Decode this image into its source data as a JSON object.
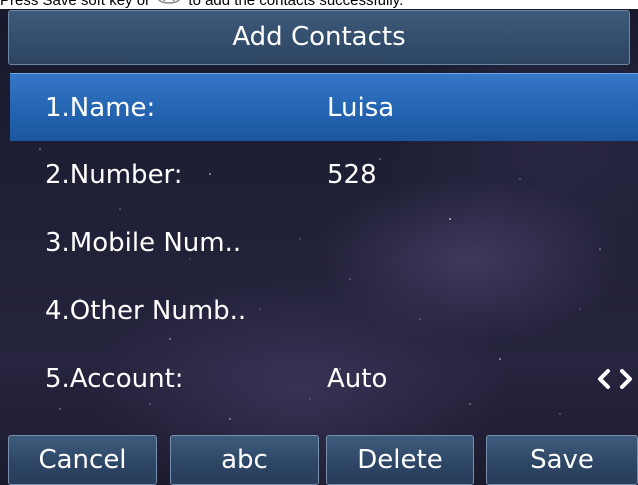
{
  "caption": {
    "text_before": "Press Save soft key or",
    "ok_icon": "ok-key-icon",
    "text_after": "to add the contacts successfully."
  },
  "screen": {
    "title": "Add Contacts",
    "fields": [
      {
        "label": "1.Name:",
        "value": "Luisa",
        "selected": true
      },
      {
        "label": "2.Number:",
        "value": "528",
        "selected": false
      },
      {
        "label": "3.Mobile Num..",
        "value": "",
        "selected": false
      },
      {
        "label": "4.Other Numb..",
        "value": "",
        "selected": false
      },
      {
        "label": "5.Account:",
        "value": "Auto",
        "selected": false,
        "has_arrows": true
      }
    ],
    "softkeys": [
      "Cancel",
      "abc",
      "Delete",
      "Save"
    ]
  },
  "colors": {
    "selection": "#2566b3",
    "softkey": "#2d4565",
    "text": "#ffffff"
  }
}
